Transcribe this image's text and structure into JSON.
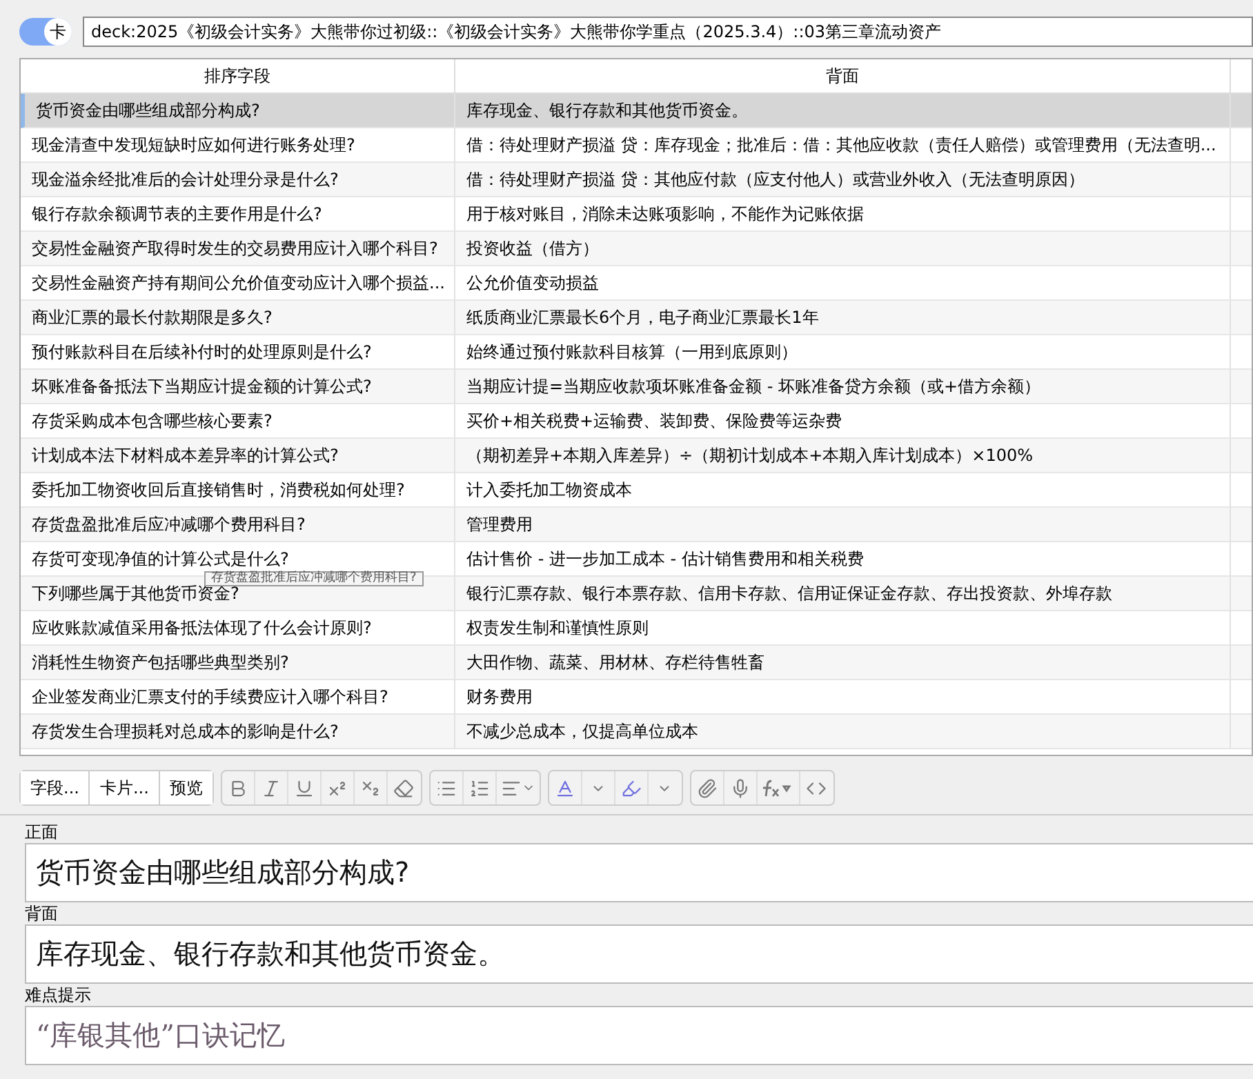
{
  "toggle": {
    "label": "卡",
    "on": true
  },
  "deck": "deck:2025《初级会计实务》大熊带你过初级::《初级会计实务》大熊带你学重点（2025.3.4）::03第三章流动资产",
  "table": {
    "columns": [
      "排序字段",
      "背面"
    ],
    "rows": [
      {
        "sort_field": "货币资金由哪些组成部分构成?",
        "back": "库存现金、银行存款和其他货币资金。",
        "selected": true
      },
      {
        "sort_field": "现金清查中发现短缺时应如何进行账务处理?",
        "back": "借：待处理财产损溢 贷：库存现金；批准后：借：其他应收款（责任人赔偿）或管理费用（无法查明...",
        "selected": false
      },
      {
        "sort_field": "现金溢余经批准后的会计处理分录是什么?",
        "back": "借：待处理财产损溢 贷：其他应付款（应支付他人）或营业外收入（无法查明原因）",
        "selected": false
      },
      {
        "sort_field": "银行存款余额调节表的主要作用是什么?",
        "back": "用于核对账目，消除未达账项影响，不能作为记账依据",
        "selected": false
      },
      {
        "sort_field": "交易性金融资产取得时发生的交易费用应计入哪个科目?",
        "back": "投资收益（借方）",
        "selected": false
      },
      {
        "sort_field": "交易性金融资产持有期间公允价值变动应计入哪个损益...",
        "back": "公允价值变动损益",
        "selected": false
      },
      {
        "sort_field": "商业汇票的最长付款期限是多久?",
        "back": "纸质商业汇票最长6个月，电子商业汇票最长1年",
        "selected": false
      },
      {
        "sort_field": "预付账款科目在后续补付时的处理原则是什么?",
        "back": "始终通过预付账款科目核算（一用到底原则）",
        "selected": false
      },
      {
        "sort_field": "坏账准备备抵法下当期应计提金额的计算公式?",
        "back": "当期应计提=当期应收款项坏账准备金额 - 坏账准备贷方余额（或+借方余额）",
        "selected": false
      },
      {
        "sort_field": "存货采购成本包含哪些核心要素?",
        "back": "买价+相关税费+运输费、装卸费、保险费等运杂费",
        "selected": false
      },
      {
        "sort_field": "计划成本法下材料成本差异率的计算公式?",
        "back": "（期初差异+本期入库差异）÷（期初计划成本+本期入库计划成本）×100%",
        "selected": false
      },
      {
        "sort_field": "委托加工物资收回后直接销售时，消费税如何处理?",
        "back": "计入委托加工物资成本",
        "selected": false
      },
      {
        "sort_field": "存货盘盈批准后应冲减哪个费用科目?",
        "back": "管理费用",
        "selected": false
      },
      {
        "sort_field": "存货可变现净值的计算公式是什么?",
        "back": "估计售价 - 进一步加工成本 - 估计销售费用和相关税费",
        "selected": false
      },
      {
        "sort_field": "下列哪些属于其他货币资金?",
        "back": "银行汇票存款、银行本票存款、信用卡存款、信用证保证金存款、存出投资款、外埠存款",
        "selected": false
      },
      {
        "sort_field": "应收账款减值采用备抵法体现了什么会计原则?",
        "back": "权责发生制和谨慎性原则",
        "selected": false
      },
      {
        "sort_field": "消耗性生物资产包括哪些典型类别?",
        "back": "大田作物、蔬菜、用材林、存栏待售牲畜",
        "selected": false
      },
      {
        "sort_field": "企业签发商业汇票支付的手续费应计入哪个科目?",
        "back": "财务费用",
        "selected": false
      },
      {
        "sort_field": "存货发生合理损耗对总成本的影响是什么?",
        "back": "不减少总成本，仅提高单位成本",
        "selected": false
      }
    ]
  },
  "tooltip": "存货盘盈批准后应冲减哪个费用科目?",
  "toolbar": {
    "buttons": [
      "字段...",
      "卡片...",
      "预览"
    ]
  },
  "fields": [
    {
      "label": "正面",
      "value": "货币资金由哪些组成部分构成?",
      "kind": "plain"
    },
    {
      "label": "背面",
      "value": "库存现金、银行存款和其他货币资金。",
      "kind": "plain"
    },
    {
      "label": "难点提示",
      "value": "“库银其他”口诀记忆",
      "kind": "serif"
    }
  ]
}
